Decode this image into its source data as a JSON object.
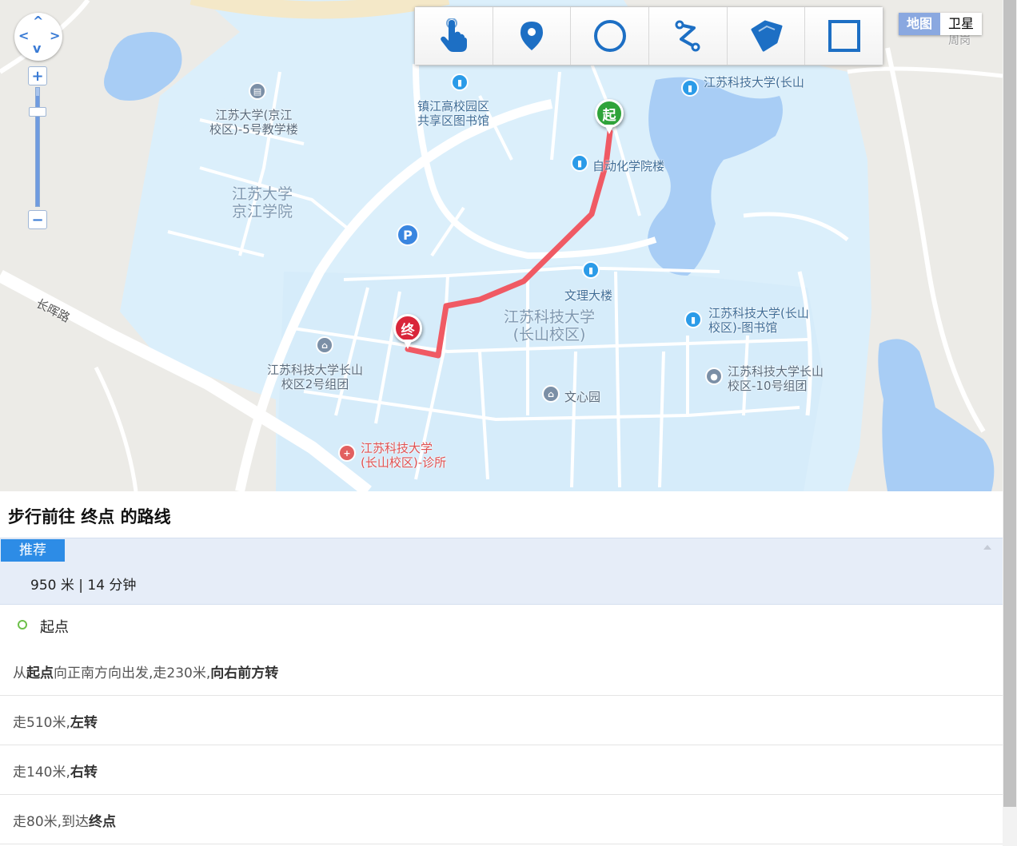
{
  "map": {
    "pois": [
      {
        "name": "江苏大学(京江",
        "name2": "校区)-5号教学楼",
        "kind": "school"
      },
      {
        "name": "镇江高校园区",
        "name2": "共享区图书馆",
        "kind": "library"
      },
      {
        "name": "江苏科技大学(长山",
        "kind": "library"
      },
      {
        "name": "自动化学院楼",
        "kind": "library"
      },
      {
        "name": "文理大楼",
        "kind": "library"
      },
      {
        "name": "江苏科技大学(长山",
        "name2": "校区)-图书馆",
        "kind": "library"
      },
      {
        "name": "江苏科技大学长山",
        "name2": "校区-10号组团",
        "kind": "building"
      },
      {
        "name": "文心园",
        "kind": "building"
      },
      {
        "name": "江苏科技大学长山",
        "name2": "校区2号组团",
        "kind": "building"
      },
      {
        "name": "江苏科技大学",
        "name2": "(长山校区)-诊所",
        "kind": "clinic"
      },
      {
        "name": "周岗",
        "kind": "village"
      }
    ],
    "area_labels": {
      "jiangsu_univ": [
        "江苏大学",
        "京江学院"
      ],
      "just": [
        "江苏科技大学",
        "(长山校区)"
      ]
    },
    "road_label": "长晖路",
    "markers": {
      "start": "起",
      "end": "终"
    },
    "parking": "P",
    "route_color": "#f05a64"
  },
  "zoom_controls": {
    "plus": "+",
    "minus": "−",
    "level_fraction": 0.93
  },
  "toolbar": {
    "tools": [
      {
        "name": "pointer-tool",
        "icon": "hand-pointer-icon"
      },
      {
        "name": "marker-tool",
        "icon": "map-pin-icon"
      },
      {
        "name": "circle-tool",
        "icon": "circle-icon"
      },
      {
        "name": "polyline-tool",
        "icon": "polyline-icon"
      },
      {
        "name": "polygon-tool",
        "icon": "polygon-icon"
      },
      {
        "name": "rectangle-tool",
        "icon": "rectangle-icon"
      }
    ],
    "icon_color": "#1d6fc4"
  },
  "map_type": {
    "map": "地图",
    "satellite": "卫星"
  },
  "route": {
    "title": "步行前往 终点 的路线",
    "tag": "推荐",
    "summary": "950 米 | 14 分钟",
    "start_label": "起点",
    "steps": [
      {
        "parts": [
          [
            "从",
            false
          ],
          [
            "起点",
            true
          ],
          [
            "向正南方向出发,走230米,",
            false
          ],
          [
            "向右前方转",
            true
          ]
        ]
      },
      {
        "parts": [
          [
            "走510米,",
            false
          ],
          [
            "左转",
            true
          ]
        ]
      },
      {
        "parts": [
          [
            "走140米,",
            false
          ],
          [
            "右转",
            true
          ]
        ]
      },
      {
        "parts": [
          [
            "走80米,到达",
            false
          ],
          [
            "终点",
            true
          ]
        ]
      }
    ]
  },
  "colors": {
    "accent": "#2d8ce6",
    "plan_bg": "#e6edf8",
    "campus": "#dbeffb",
    "water": "#a8cdf5",
    "start_green": "#2fa33a",
    "end_red": "#d9263a"
  }
}
